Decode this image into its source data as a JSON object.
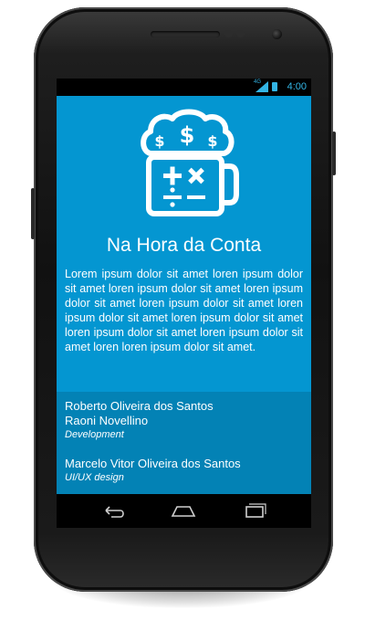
{
  "status_bar": {
    "network_type": "4G",
    "time": "4:00"
  },
  "app": {
    "title": "Na Hora da Conta",
    "description": "Lorem ipsum dolor sit amet loren ipsum dolor sit amet loren ipsum dolor sit amet loren ipsum dolor sit amet loren ipsum dolor sit amet loren ipsum dolor sit amet loren ipsum dolor sit amet loren ipsum dolor sit amet loren ipsum dolor sit amet loren loren ipsum dolor sit amet."
  },
  "credits": {
    "development": {
      "names": [
        "Roberto Oliveira dos Santos",
        "Raoni Novellino"
      ],
      "role": "Development"
    },
    "design": {
      "names": [
        "Marcelo Vitor Oliveira dos Santos"
      ],
      "role": "UI/UX design"
    }
  },
  "navigation": {
    "buttons": [
      "back-icon",
      "home-icon",
      "recent-apps-icon"
    ]
  },
  "colors": {
    "screen_background": "#0496d1",
    "credits_background": "#0382b5",
    "status_accent": "#33b5e5"
  }
}
